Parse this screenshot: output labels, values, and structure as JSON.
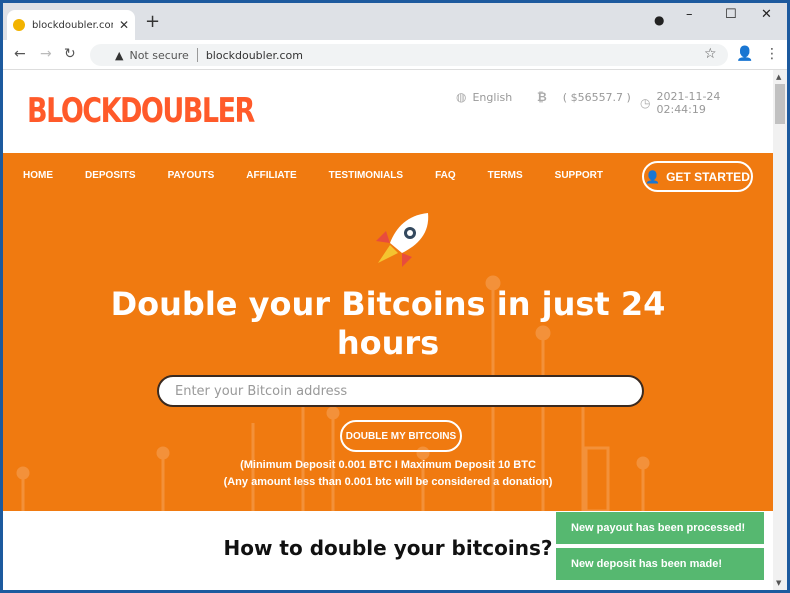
{
  "browser": {
    "tab_title": "blockdoubler.com - Most Trusted",
    "security": "Not secure",
    "url": "blockdoubler.com"
  },
  "header": {
    "logo": "BLOCKDOUBLER",
    "language": "English",
    "btc_price": "( $56557.7 )",
    "datetime": "2021-11-24 02:44:19"
  },
  "nav": {
    "items": [
      "HOME",
      "DEPOSITS",
      "PAYOUTS",
      "AFFILIATE",
      "TESTIMONIALS",
      "FAQ",
      "TERMS",
      "SUPPORT"
    ],
    "cta": "GET STARTED"
  },
  "hero": {
    "headline_line1": "Double your Bitcoins in just 24",
    "headline_line2": "hours",
    "address_placeholder": "Enter your Bitcoin address",
    "button": "DOUBLE MY BITCOINS",
    "note1": "(Minimum Deposit 0.001 BTC I Maximum Deposit 10 BTC",
    "note2": "(Any amount less than 0.001 btc will be considered a donation)"
  },
  "section_title": "How to double your bitcoins?",
  "toasts": [
    "New payout has been processed!",
    "New deposit has been made!"
  ],
  "colors": {
    "accent": "#f07a10",
    "logo": "#ff5a2a",
    "toast": "#56b870"
  }
}
